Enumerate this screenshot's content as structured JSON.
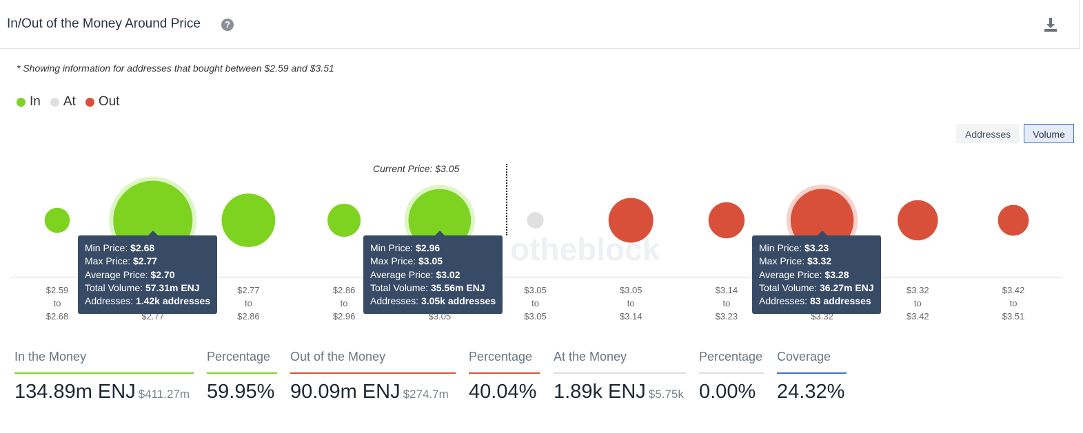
{
  "header": {
    "title": "In/Out of the Money Around Price",
    "help_icon": "question-circle-icon",
    "download_icon": "download-icon"
  },
  "note": "* Showing information for addresses that bought between $2.59 and $3.51",
  "legend": [
    {
      "label": "In",
      "color": "#7ed321"
    },
    {
      "label": "At",
      "color": "#e0e0e0"
    },
    {
      "label": "Out",
      "color": "#d9503a"
    }
  ],
  "toggle": {
    "addresses": "Addresses",
    "volume": "Volume",
    "selected": "Volume"
  },
  "current_price": {
    "label": "Current Price: $3.05"
  },
  "watermark": "intotheblock",
  "chart_data": {
    "type": "bubble",
    "size_metric": "Total Volume (m ENJ, estimated where not labeled)",
    "x_ranges": [
      {
        "from": "$2.59",
        "to": "$2.68",
        "status": "in",
        "volume": 5.8
      },
      {
        "from": "$2.68",
        "to": "$2.77",
        "status": "in",
        "volume": 57.31,
        "highlight": true
      },
      {
        "from": "$2.77",
        "to": "$2.86",
        "status": "in",
        "volume": 26.2
      },
      {
        "from": "$2.86",
        "to": "$2.96",
        "status": "in",
        "volume": 10.0
      },
      {
        "from": "$2.96",
        "to": "$3.05",
        "status": "in",
        "volume": 35.56,
        "highlight": true
      },
      {
        "from": "$3.05",
        "to": "$3.05",
        "status": "at",
        "volume": 0.00189
      },
      {
        "from": "$3.05",
        "to": "$3.14",
        "status": "out",
        "volume": 18.3
      },
      {
        "from": "$3.14",
        "to": "$3.23",
        "status": "out",
        "volume": 11.9
      },
      {
        "from": "$3.23",
        "to": "$3.32",
        "status": "out",
        "volume": 36.27,
        "highlight": true
      },
      {
        "from": "$3.32",
        "to": "$3.42",
        "status": "out",
        "volume": 14.8
      },
      {
        "from": "$3.42",
        "to": "$3.51",
        "status": "out",
        "volume": 8.7
      }
    ],
    "tick_sep": "to"
  },
  "tooltips": [
    {
      "index": 1,
      "min_label": "Min Price:",
      "min": "$2.68",
      "max_label": "Max Price:",
      "max": "$2.77",
      "avg_label": "Average Price:",
      "avg": "$2.70",
      "vol_label": "Total Volume:",
      "vol": "57.31m ENJ",
      "addr_label": "Addresses:",
      "addr": "1.42k addresses"
    },
    {
      "index": 4,
      "min_label": "Min Price:",
      "min": "$2.96",
      "max_label": "Max Price:",
      "max": "$3.05",
      "avg_label": "Average Price:",
      "avg": "$3.02",
      "vol_label": "Total Volume:",
      "vol": "35.56m ENJ",
      "addr_label": "Addresses:",
      "addr": "3.05k addresses"
    },
    {
      "index": 8,
      "min_label": "Min Price:",
      "min": "$3.23",
      "max_label": "Max Price:",
      "max": "$3.32",
      "avg_label": "Average Price:",
      "avg": "$3.28",
      "vol_label": "Total Volume:",
      "vol": "36.27m ENJ",
      "addr_label": "Addresses:",
      "addr": "83 addresses"
    }
  ],
  "stats": {
    "in": {
      "label": "In the Money",
      "value": "134.89m ENJ",
      "usd": "$411.27m",
      "color": "#7ed321"
    },
    "in_pct": {
      "label": "Percentage",
      "value": "59.95%",
      "color": "#7ed321"
    },
    "out": {
      "label": "Out of the Money",
      "value": "90.09m ENJ",
      "usd": "$274.7m",
      "color": "#d9503a"
    },
    "out_pct": {
      "label": "Percentage",
      "value": "40.04%",
      "color": "#d9503a"
    },
    "at": {
      "label": "At the Money",
      "value": "1.89k ENJ",
      "usd": "$5.75k",
      "color": "#dcdfe3"
    },
    "at_pct": {
      "label": "Percentage",
      "value": "0.00%",
      "color": "#dcdfe3"
    },
    "coverage": {
      "label": "Coverage",
      "value": "24.32%",
      "color": "#3b73d1"
    }
  }
}
